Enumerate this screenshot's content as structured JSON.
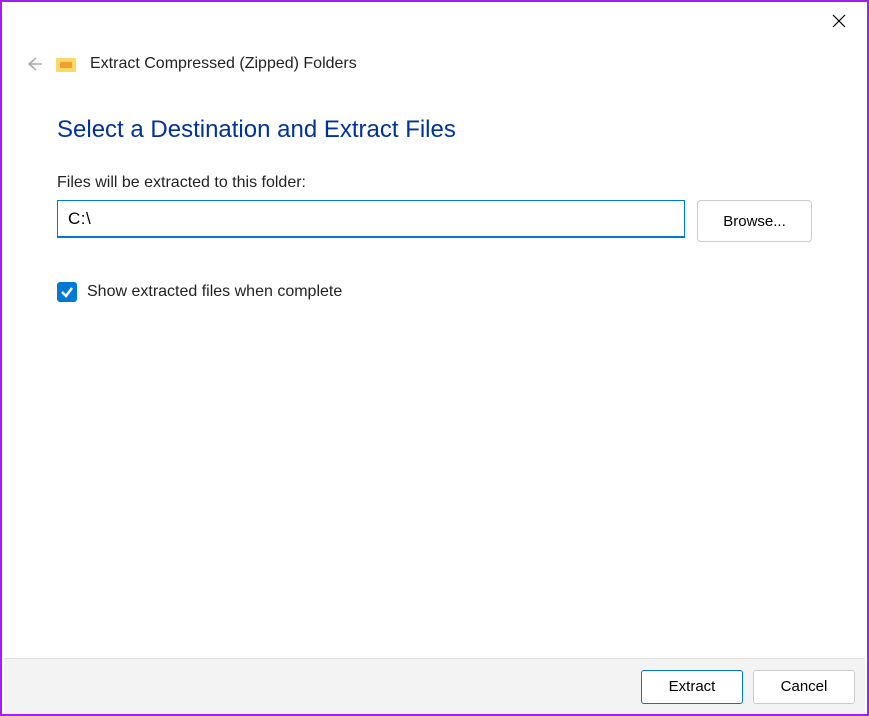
{
  "window": {
    "title": "Extract Compressed (Zipped) Folders"
  },
  "content": {
    "heading": "Select a Destination and Extract Files",
    "field_label": "Files will be extracted to this folder:",
    "path_value": "C:\\",
    "browse_label": "Browse...",
    "checkbox_label": "Show extracted files when complete",
    "checkbox_checked": true
  },
  "footer": {
    "extract_label": "Extract",
    "cancel_label": "Cancel"
  }
}
